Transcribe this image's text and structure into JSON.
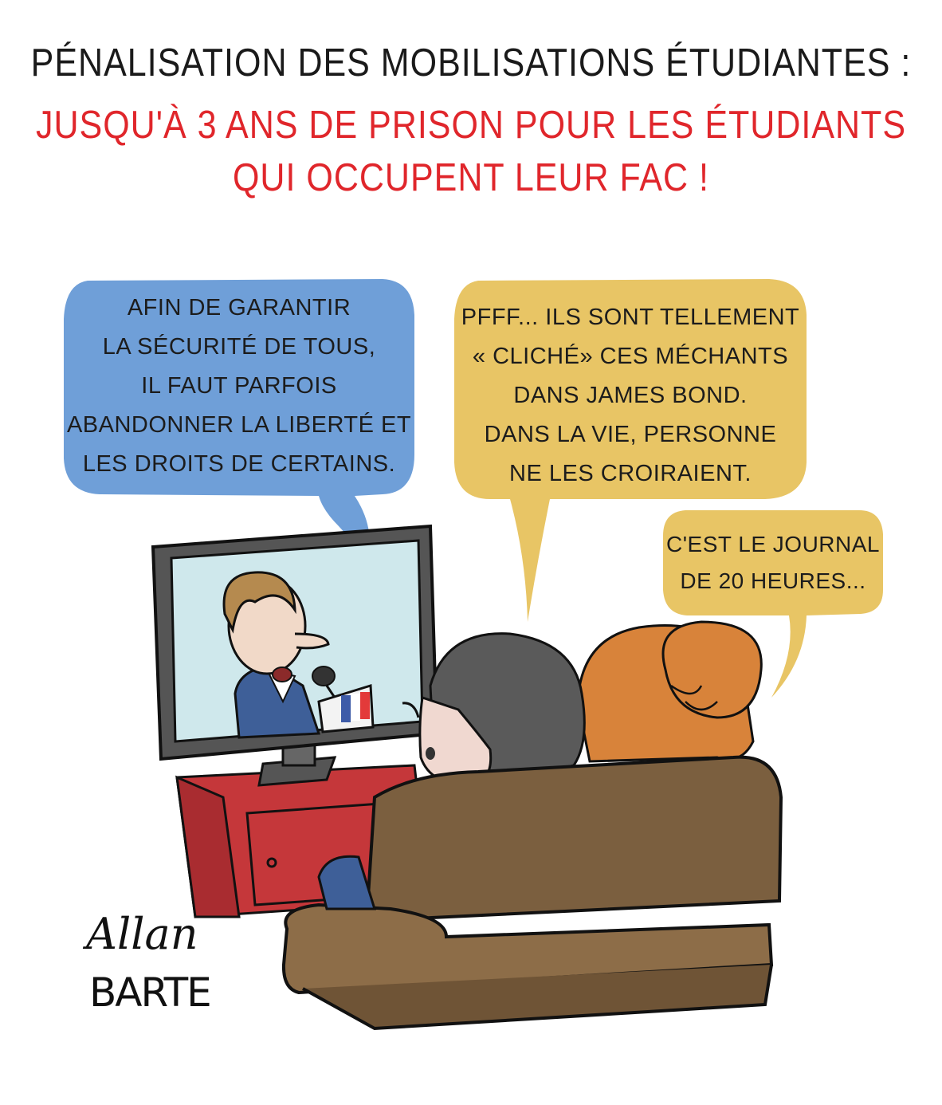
{
  "title": {
    "line1": "Pénalisation des mobilisations étudiantes :",
    "line2": "Jusqu'à 3 ans de prison pour les étudiants",
    "line3": "qui occupent leur fac !"
  },
  "bubbles": {
    "tv": [
      "Afin de garantir",
      "la sécurité de tous,",
      "il faut parfois",
      "abandonner la liberté et",
      "les droits de certains."
    ],
    "man": [
      "Pfff... Ils sont tellement",
      "« cliché» ces méchants",
      "dans James Bond.",
      "Dans la vie, personne",
      "ne les croiraient."
    ],
    "woman": [
      "C'est le journal",
      "de 20 heures..."
    ]
  },
  "signature": {
    "line1": "Allan",
    "line2": "BARTE"
  },
  "colors": {
    "title": "#1a1a1a",
    "accent": "#e0262b",
    "bubble_blue": "#6f9fd8",
    "bubble_yellow": "#e8c565",
    "cabinet": "#c5373a",
    "sofa": "#7b5f3f",
    "hair_woman": "#d8833a"
  }
}
